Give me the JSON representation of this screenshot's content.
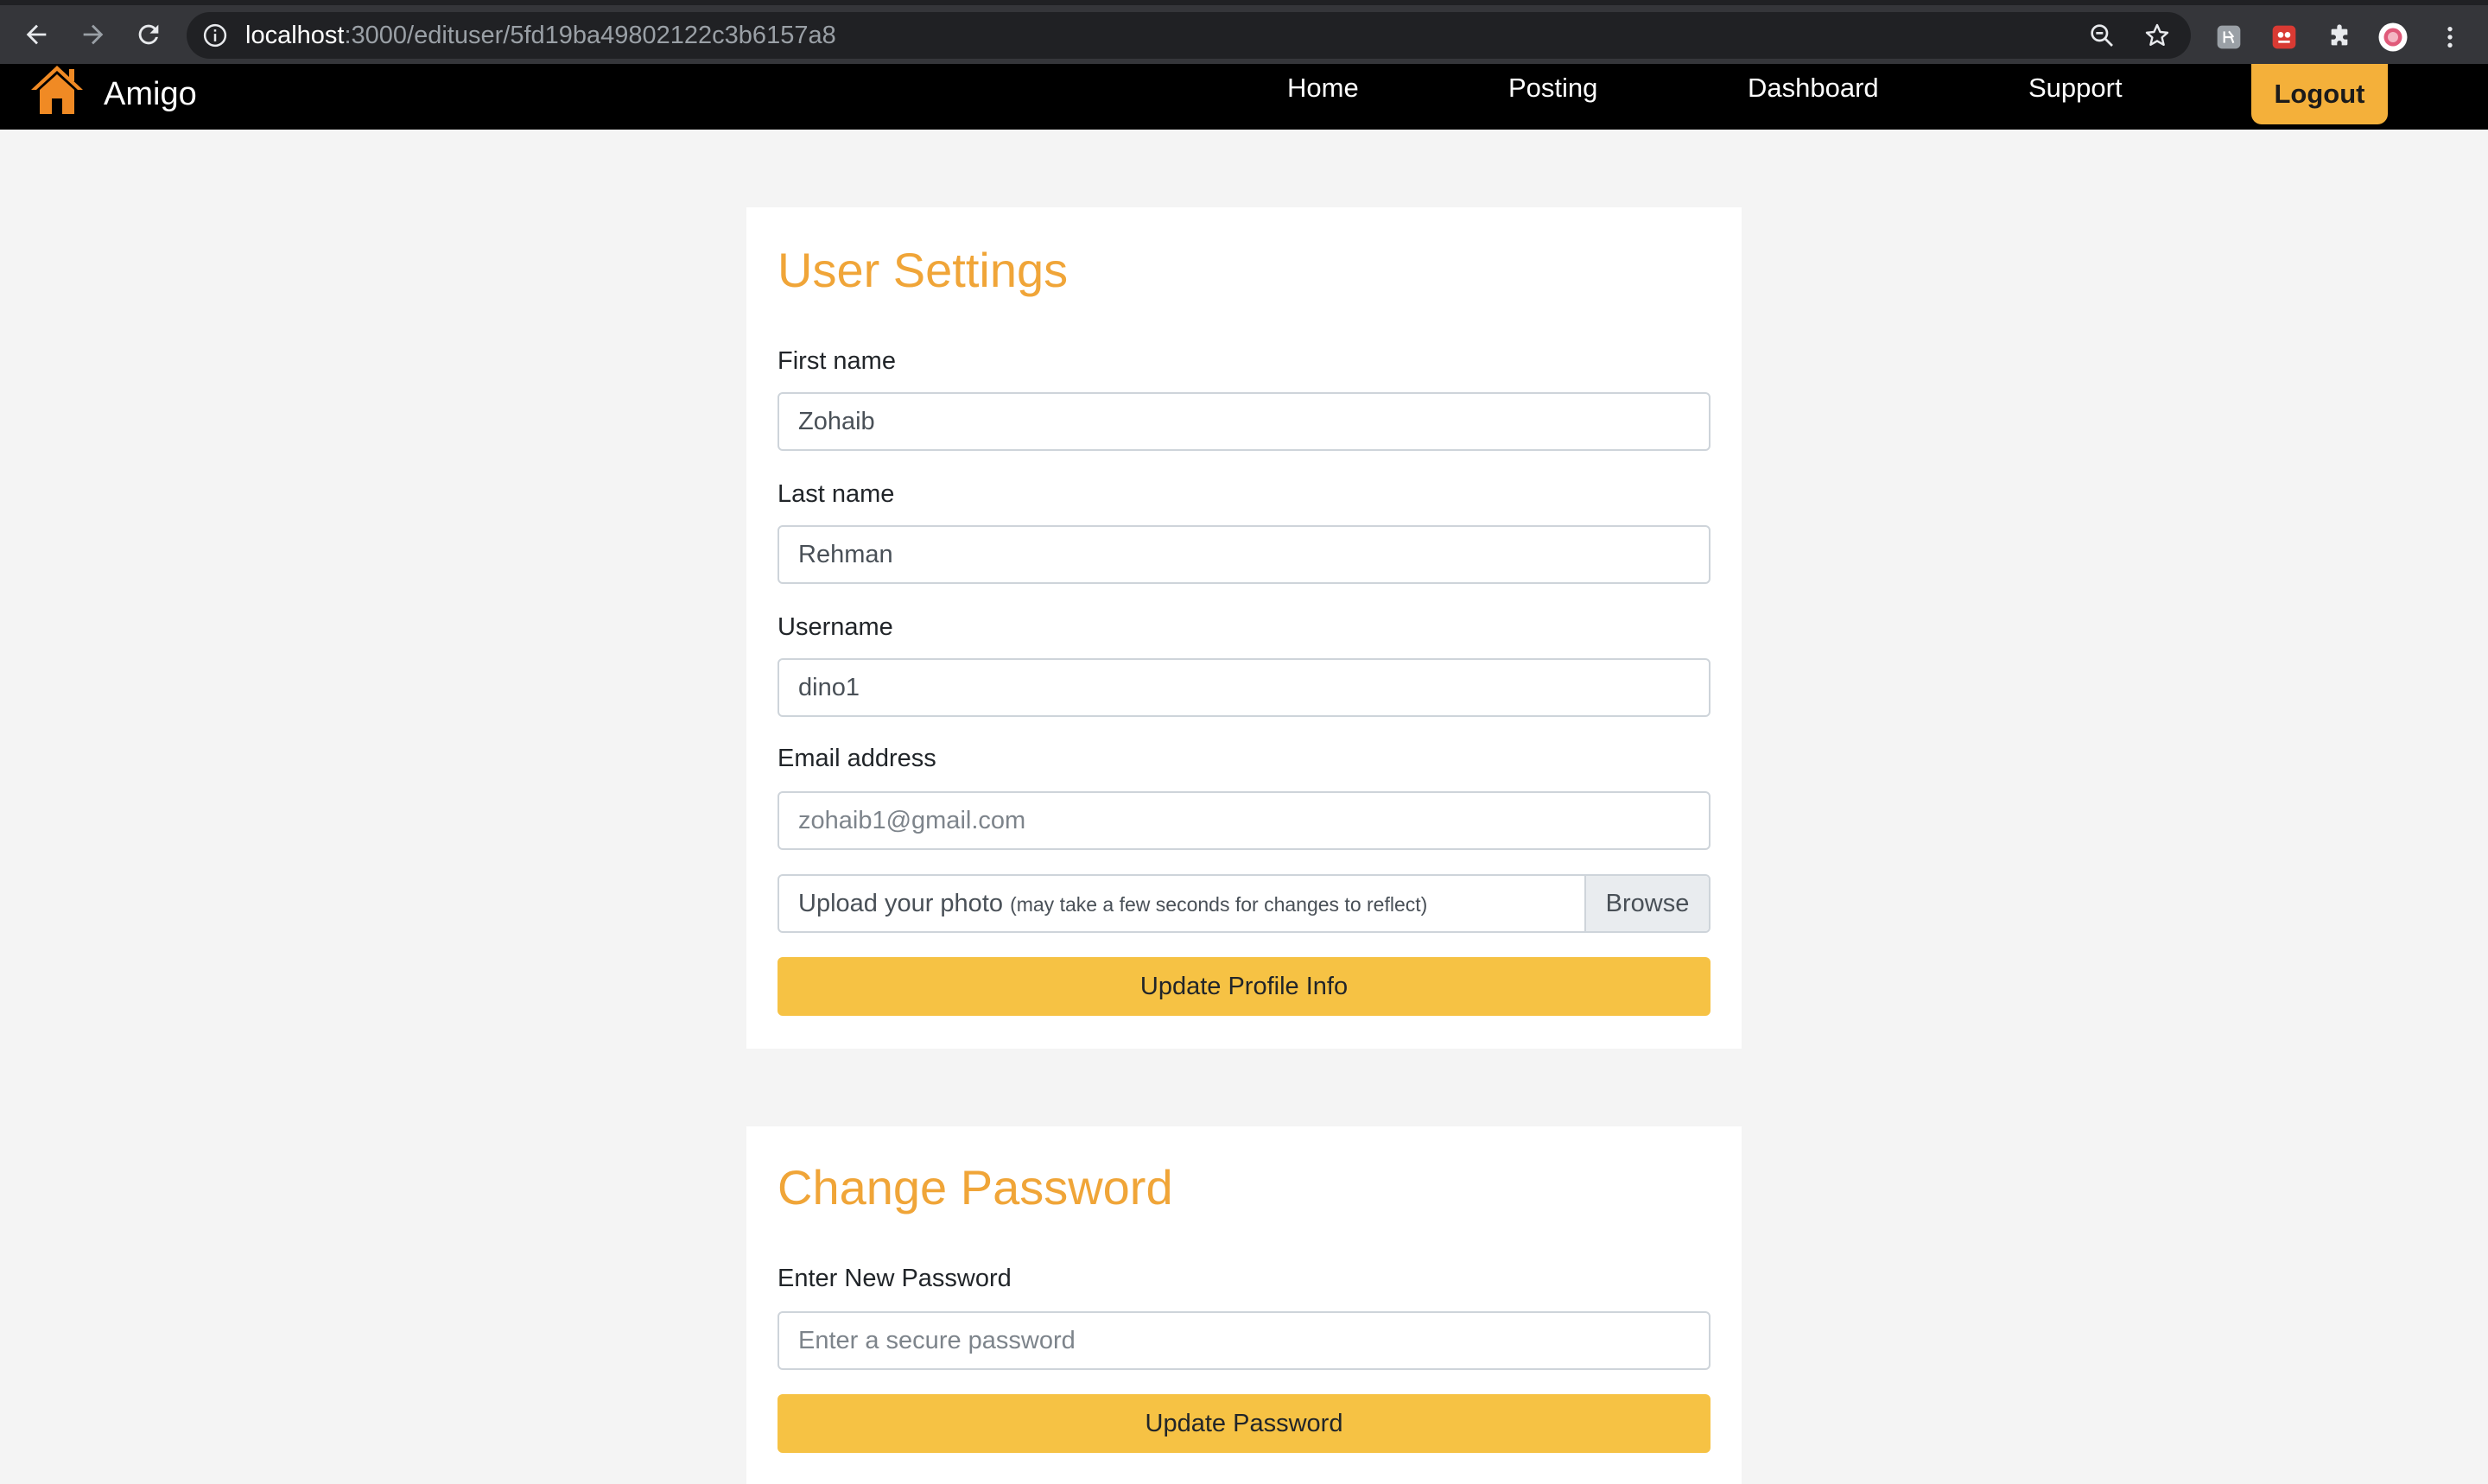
{
  "browser": {
    "url_host": "localhost",
    "url_path": ":3000/edituser/5fd19ba49802122c3b6157a8"
  },
  "navbar": {
    "brand": "Amigo",
    "links": [
      "Home",
      "Posting",
      "Dashboard",
      "Support"
    ],
    "logout_label": "Logout",
    "accent_color": "#f4b03a"
  },
  "user_settings": {
    "title": "User Settings",
    "first_name_label": "First name",
    "first_name_value": "Zohaib",
    "last_name_label": "Last name",
    "last_name_value": "Rehman",
    "username_label": "Username",
    "username_value": "dino1",
    "email_label": "Email address",
    "email_placeholder": "zohaib1@gmail.com",
    "upload_label": "Upload your photo",
    "upload_hint": "(may take a few seconds for changes to reflect)",
    "browse_label": "Browse",
    "submit_label": "Update Profile Info"
  },
  "change_password": {
    "title": "Change Password",
    "new_password_label": "Enter New Password",
    "new_password_placeholder": "Enter a secure password",
    "submit_label": "Update Password"
  },
  "colors": {
    "title_orange": "#f0a538",
    "button_yellow": "#f6c244"
  }
}
